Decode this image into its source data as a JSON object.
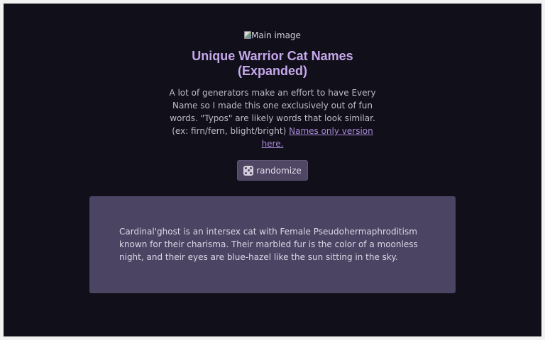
{
  "image": {
    "alt": "Main image"
  },
  "header": {
    "title_line1": "Unique Warrior Cat Names",
    "title_line2": "(Expanded)"
  },
  "description": {
    "text": "A lot of generators make an effort to have Every Name so I made this one exclusively out of fun words. \"Typos\" are likely words that look similar. (ex: firn/fern, blight/bright)",
    "link_text": "Names only version here."
  },
  "controls": {
    "randomize_label": "randomize",
    "randomize_icon": "dice-icon"
  },
  "result": {
    "text": "Cardinal'ghost is an intersex cat with Female Pseudohermaphroditism known for their charisma. Their marbled fur is the color of a moonless night, and their eyes are blue-hazel like the sun sitting in the sky."
  },
  "colors": {
    "background": "#110f1a",
    "title": "#c5a8ea",
    "link": "#a88ad8",
    "button": "#4e4663",
    "card": "#4b4463"
  }
}
